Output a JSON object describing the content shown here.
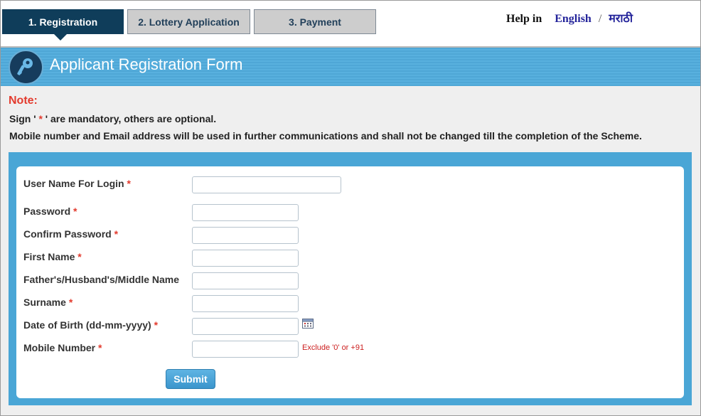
{
  "steps": [
    {
      "label": "1. Registration"
    },
    {
      "label": "2. Lottery Application"
    },
    {
      "label": "3. Payment"
    }
  ],
  "help": {
    "prefix": "Help in",
    "english": "English",
    "separator": "/",
    "marathi": "मराठी"
  },
  "banner": {
    "title": "Applicant Registration Form",
    "icon": "key-icon"
  },
  "note": {
    "heading": "Note:",
    "mandatory_pre": "Sign ' ",
    "mandatory_star": "*",
    "mandatory_post": " ' are mandatory, others are optional.",
    "info": "Mobile number and Email address will be used in further communications and shall not be changed till the completion of the Scheme."
  },
  "form": {
    "fields": [
      {
        "label": "User Name For Login",
        "required": "*",
        "value": ""
      },
      {
        "label": "Password",
        "required": "*",
        "value": ""
      },
      {
        "label": "Confirm Password",
        "required": "*",
        "value": ""
      },
      {
        "label": "First Name",
        "required": "*",
        "value": ""
      },
      {
        "label": "Father's/Husband's/Middle Name",
        "required": "",
        "value": ""
      },
      {
        "label": "Surname",
        "required": "*",
        "value": ""
      },
      {
        "label": "Date of Birth (dd-mm-yyyy)",
        "required": "*",
        "value": ""
      },
      {
        "label": "Mobile Number",
        "required": "*",
        "value": ""
      }
    ],
    "mobile_hint": "Exclude '0' or +91",
    "calendar_icon": "calendar-icon",
    "submit_label": "Submit"
  },
  "colors": {
    "accent_dark": "#0f3d5a",
    "banner_blue": "#4fa7d6",
    "required_red": "#e33b2e",
    "hint_red": "#cc1f1f"
  }
}
